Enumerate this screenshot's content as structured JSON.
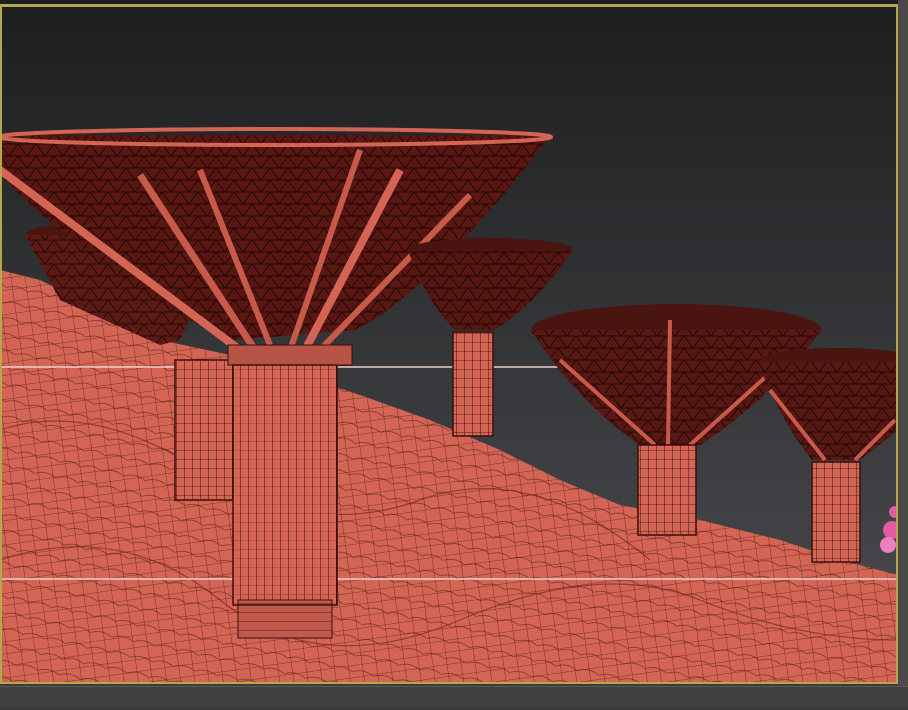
{
  "viewport": {
    "label": "",
    "frame_color": "#b6a84a",
    "background_top": "#1e1f21",
    "background_bottom": "#4a4c4e",
    "mesh_color": "#d86a5c",
    "wire_color": "#3a0f0c",
    "shading_mode": "wireframe-override"
  },
  "scene": {
    "objects": [
      "terrain-mesh",
      "canopy-tower-1",
      "canopy-tower-2",
      "canopy-tower-3",
      "canopy-tower-4",
      "canopy-tower-5",
      "canopy-tower-6",
      "selected-tree"
    ]
  }
}
